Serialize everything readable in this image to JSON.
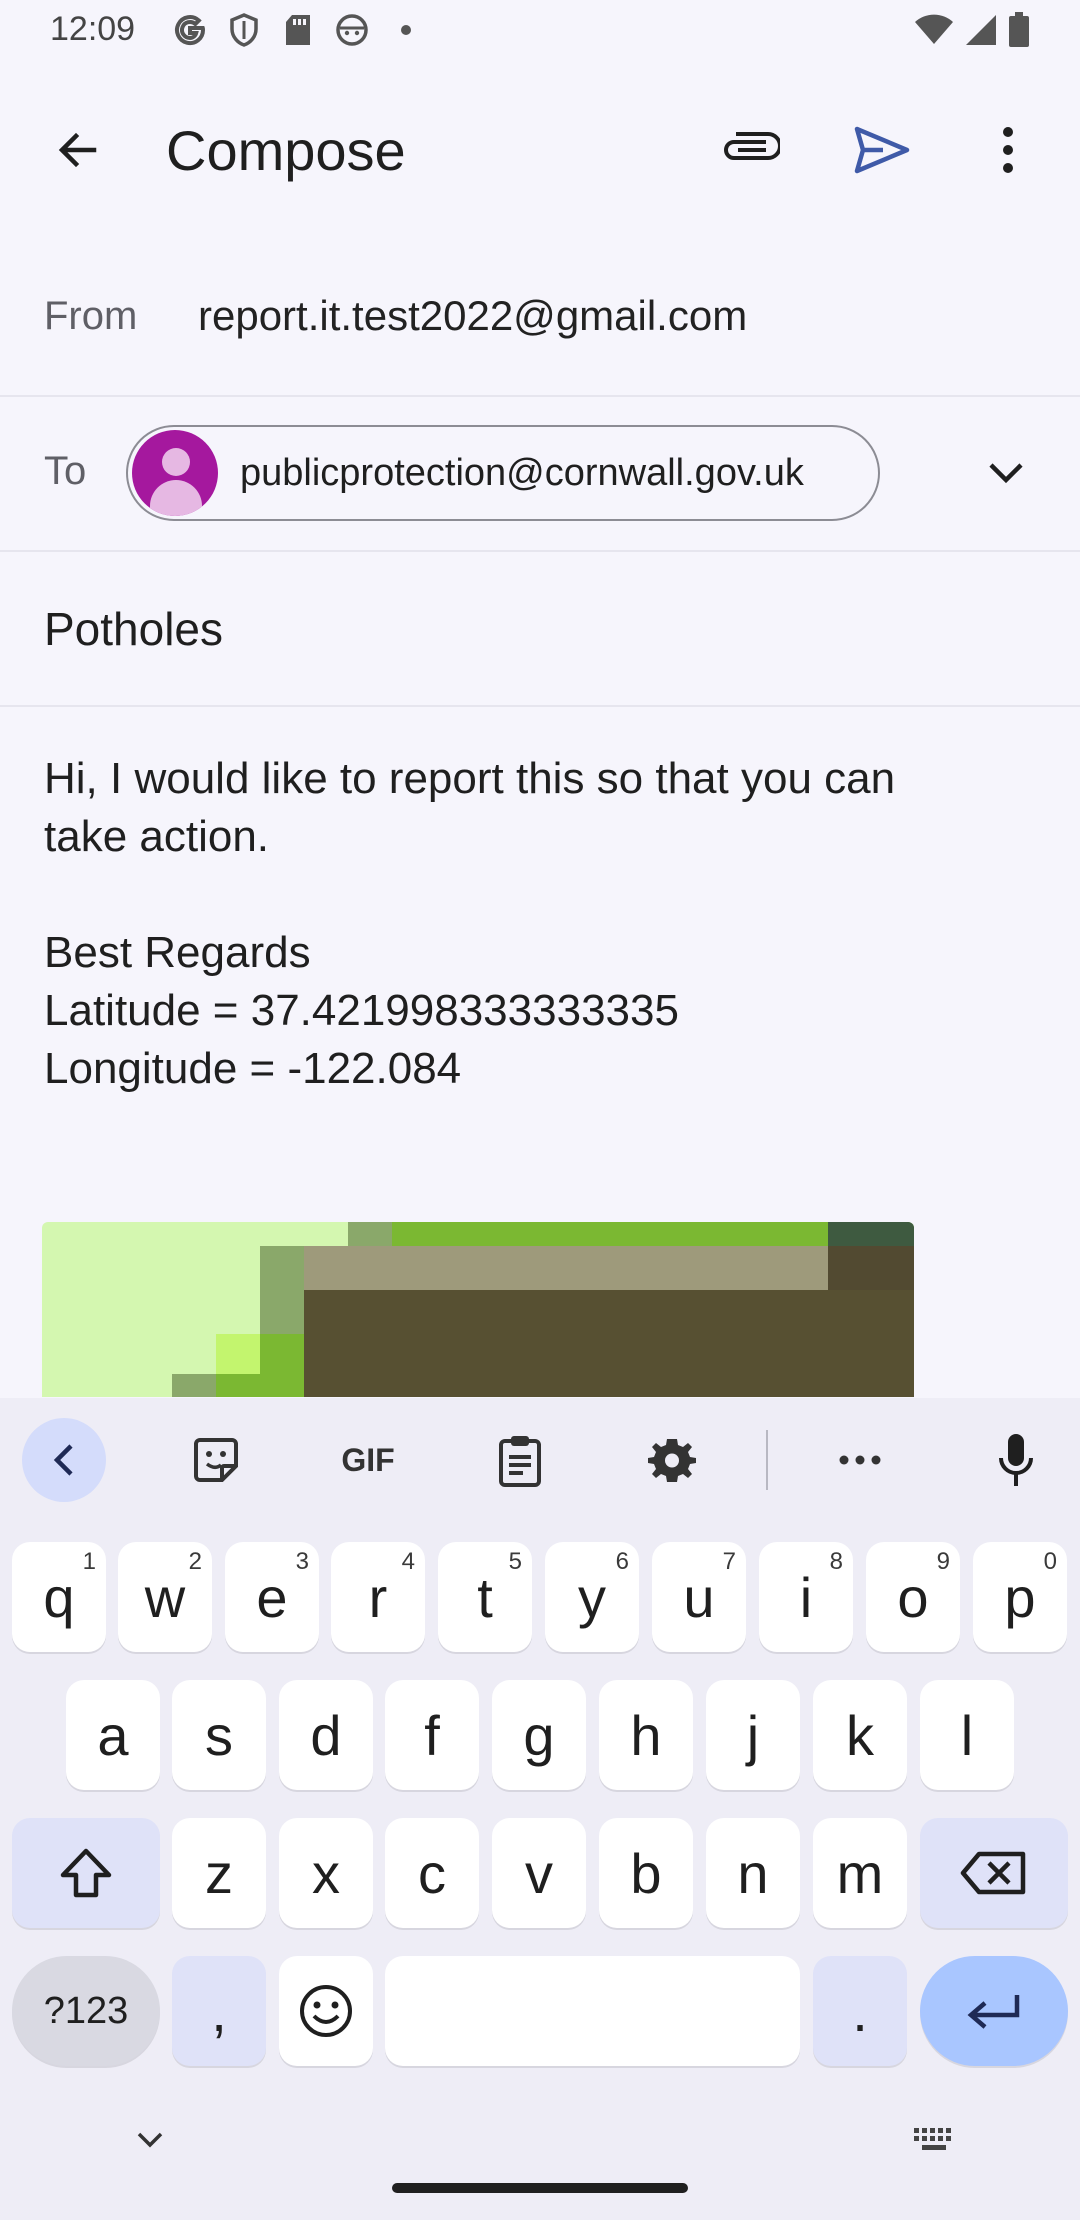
{
  "status": {
    "time": "12:09"
  },
  "appbar": {
    "title": "Compose"
  },
  "from": {
    "label": "From",
    "value": "report.it.test2022@gmail.com"
  },
  "to": {
    "label": "To",
    "recipient": "publicprotection@cornwall.gov.uk"
  },
  "subject": "Potholes",
  "body": {
    "line1": "Hi, I would like to report this so that you can",
    "line2": "take action.",
    "line3": "",
    "line4": "Best Regards",
    "line5": "Latitude = 37.421998333333335",
    "line6": "Longitude = -122.084"
  },
  "keyboard": {
    "toolbar": {
      "gif": "GIF"
    },
    "row1": [
      {
        "k": "q",
        "h": "1"
      },
      {
        "k": "w",
        "h": "2"
      },
      {
        "k": "e",
        "h": "3"
      },
      {
        "k": "r",
        "h": "4"
      },
      {
        "k": "t",
        "h": "5"
      },
      {
        "k": "y",
        "h": "6"
      },
      {
        "k": "u",
        "h": "7"
      },
      {
        "k": "i",
        "h": "8"
      },
      {
        "k": "o",
        "h": "9"
      },
      {
        "k": "p",
        "h": "0"
      }
    ],
    "row2": [
      "a",
      "s",
      "d",
      "f",
      "g",
      "h",
      "j",
      "k",
      "l"
    ],
    "row3": [
      "z",
      "x",
      "c",
      "v",
      "b",
      "n",
      "m"
    ],
    "symbols": "?123",
    "comma": ",",
    "period": "."
  },
  "colors": {
    "accent": "#3f5aa8",
    "avatar": "#a5189e",
    "enter": "#a9c6ff"
  }
}
